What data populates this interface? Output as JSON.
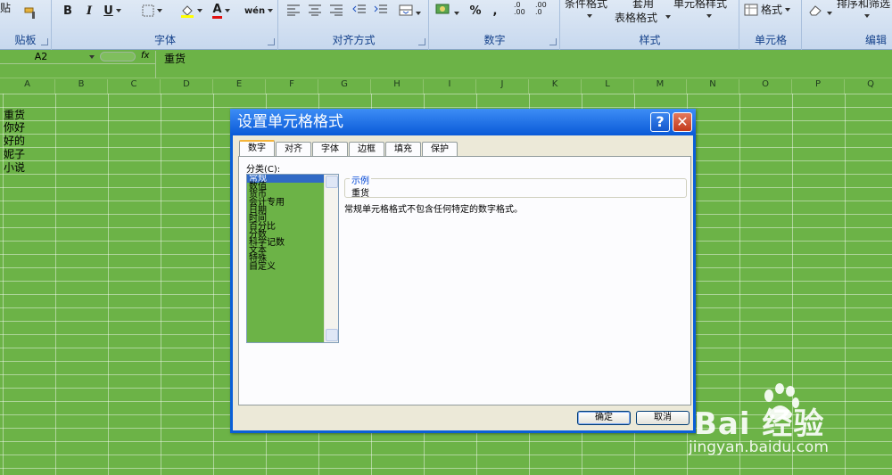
{
  "ribbon": {
    "clipboard_paste_label": "贴",
    "clipboard_label": "贴板",
    "font_label": "字体",
    "alignment_label": "对齐方式",
    "number_label": "数字",
    "styles_label": "样式",
    "cells_label": "单元格",
    "edit_label": "编辑",
    "bold_label": "B",
    "italic_label": "I",
    "underline_label": "U",
    "percent_label": "%",
    "comma_label": ",",
    "inc_decimal_label": ".0 .00",
    "dec_decimal_label": ".00 .0",
    "conditional_format_label": "条件格式",
    "apply_label": "套用",
    "table_format_label": "表格格式",
    "cell_style_label": "单元格样式",
    "format_label": "格式",
    "sort_filter_label": "排序和筛选",
    "wen_label": "wén",
    "font_color_letter": "A"
  },
  "formula_bar": {
    "name_box": "A2",
    "fx_label": "fx",
    "value": "重货"
  },
  "grid": {
    "columns": [
      "A",
      "B",
      "C",
      "D",
      "E",
      "F",
      "G",
      "H",
      "I",
      "J",
      "K",
      "L",
      "M",
      "N",
      "O",
      "P",
      "Q"
    ],
    "column_a_values": [
      "重货",
      "你好",
      "好的",
      "妮子",
      "小说"
    ]
  },
  "dialog": {
    "title": "设置单元格格式",
    "help_label": "?",
    "close_label": "✕",
    "tabs": [
      "数字",
      "对齐",
      "字体",
      "边框",
      "填充",
      "保护"
    ],
    "active_tab": "数字",
    "category_label": "分类(C):",
    "categories": [
      "常规",
      "数值",
      "货币",
      "会计专用",
      "日期",
      "时间",
      "百分比",
      "分数",
      "科学记数",
      "文本",
      "特殊",
      "自定义"
    ],
    "selected_category": "常规",
    "sample_legend": "示例",
    "sample_value": "重货",
    "description": "常规单元格格式不包含任何特定的数字格式。",
    "ok_label": "确定",
    "cancel_label": "取消"
  },
  "watermark": {
    "brand": "Bai 经验",
    "url": "jingyan.baidu.com"
  },
  "colors": {
    "sheet_green": "#6cb347",
    "dialog_title_blue": "#0a5ad8",
    "selected_item": "#316ac5"
  }
}
